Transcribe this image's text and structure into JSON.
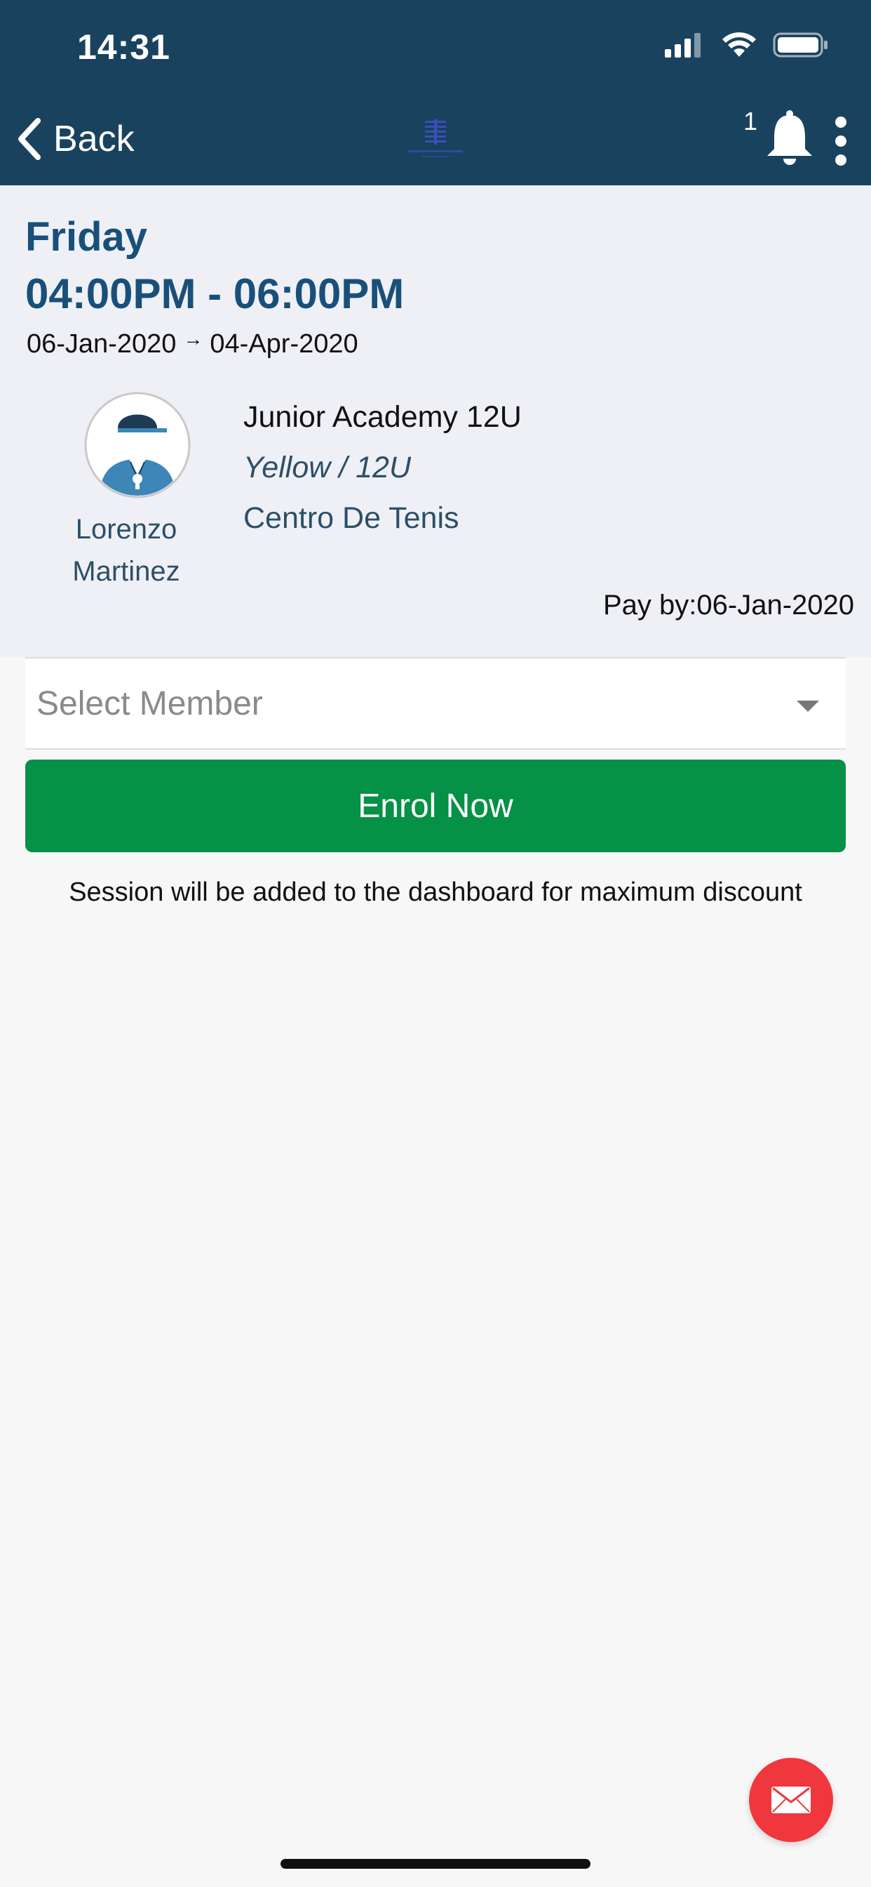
{
  "status_bar": {
    "time": "14:31"
  },
  "nav": {
    "back_label": "Back",
    "notification_count": "1"
  },
  "session": {
    "day": "Friday",
    "time_range": "04:00PM - 06:00PM",
    "start_date": "06-Jan-2020",
    "end_date": "04-Apr-2020",
    "date_arrow": "→",
    "coach_first_name": "Lorenzo",
    "coach_last_name": "Martinez",
    "class_name": "Junior Academy 12U",
    "level": "Yellow / 12U",
    "venue": "Centro De Tenis",
    "pay_by": "Pay by:06-Jan-2020"
  },
  "member_select": {
    "placeholder": "Select Member"
  },
  "enrol": {
    "button_label": "Enrol Now",
    "hint": "Session will be added to the dashboard for maximum discount"
  },
  "colors": {
    "header": "#19425e",
    "primary_text": "#19507a",
    "enrol": "#059146",
    "mail_fab": "#f0373d"
  },
  "icons": [
    "chevron-left-icon",
    "bell-icon",
    "more-vertical-icon",
    "signal-icon",
    "wifi-icon",
    "battery-icon",
    "mail-icon",
    "coach-avatar"
  ]
}
